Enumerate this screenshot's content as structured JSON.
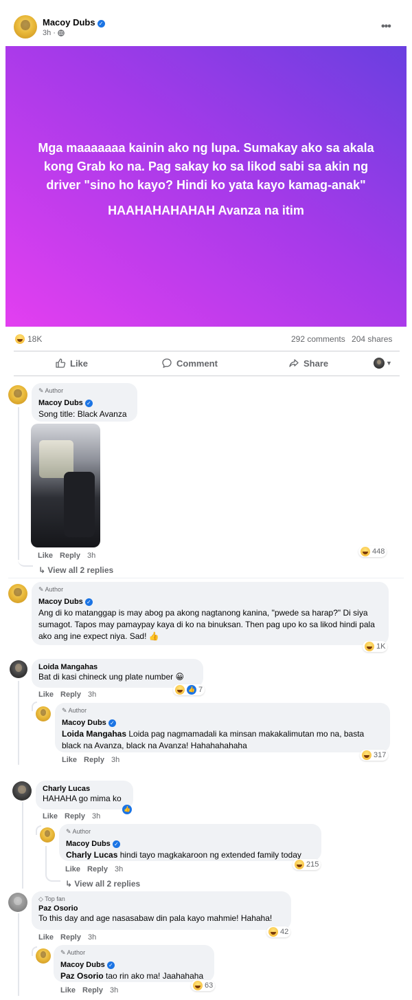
{
  "post": {
    "author": "Macoy Dubs",
    "time": "3h ·",
    "more_icon": "more-horizontal-icon",
    "banner_line1": "Mga maaaaaaa kainin ako ng lupa. Sumakay ako sa akala kong Grab ko na. Pag sakay ko sa likod sabi sa akin ng driver \"sino ho kayo? Hindi ko yata kayo kamag-anak\"",
    "banner_line2": "HAAHAHAHAHAH Avanza na itim",
    "banner_colors": [
      "#6a3fe0",
      "#a53ae9",
      "#e33ff0"
    ],
    "reactions_count": "18K",
    "comments_count": "292 comments",
    "shares_count": "204 shares",
    "actions": {
      "like": "Like",
      "comment": "Comment",
      "share": "Share"
    }
  },
  "comments": [
    {
      "tag": "Author",
      "name": "Macoy Dubs",
      "text": "Song title: Black Avanza",
      "like": "Like",
      "reply": "Reply",
      "time": "3h",
      "reactions": "448",
      "view_replies": "View all 2 replies"
    },
    {
      "tag": "Author",
      "name": "Macoy Dubs",
      "text": "Ang di ko matanggap is may abog pa akong nagtanong kanina, \"pwede sa harap?\" Di siya sumagot. Tapos may pamaypay kaya di ko na binuksan. Then pag upo ko sa likod hindi pala ako ang ine expect niya. Sad! 👍",
      "reactions": "1K"
    },
    {
      "name": "Loida Mangahas",
      "text": "Bat di kasi chineck ung plate number 😀",
      "like": "Like",
      "reply": "Reply",
      "time": "3h",
      "reactions": "7",
      "reply_item": {
        "tag": "Author",
        "name": "Macoy Dubs",
        "mention": "Loida Mangahas",
        "text": " Loida pag nagmamadali ka minsan makakalimutan mo na, basta black na Avanza, black na Avanza! Hahahahahaha",
        "like": "Like",
        "reply": "Reply",
        "time": "3h",
        "reactions": "317"
      }
    },
    {
      "name": "Charly Lucas",
      "text": "HAHAHA go mima ko",
      "like": "Like",
      "reply": "Reply",
      "time": "3h",
      "reply_item": {
        "tag": "Author",
        "name": "Macoy Dubs",
        "mention": "Charly Lucas",
        "text": " hindi tayo magkakaroon ng extended family today",
        "like": "Like",
        "reply": "Reply",
        "time": "3h",
        "reactions": "215"
      },
      "view_replies": "View all 2 replies"
    },
    {
      "tag": "Top fan",
      "name": "Paz Osorio",
      "text": "To this day and age nasasabaw din pala kayo mahmie! Hahaha!",
      "like": "Like",
      "reply": "Reply",
      "time": "3h",
      "reactions": "42",
      "reply_item": {
        "tag": "Author",
        "name": "Macoy Dubs",
        "mention": "Paz Osorio",
        "text": " tao rin ako ma! Jaahahaha",
        "like": "Like",
        "reply": "Reply",
        "time": "3h",
        "reactions": "63"
      }
    }
  ]
}
